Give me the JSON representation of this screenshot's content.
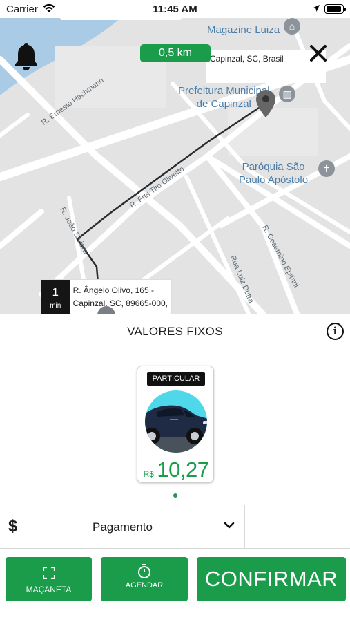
{
  "status_bar": {
    "carrier": "Carrier",
    "time": "11:45 AM"
  },
  "map": {
    "distance": "0,5 km",
    "destination": "Capinzal, SC, Brasil",
    "poi_magazine": "Magazine Luiza",
    "poi_prefeitura_line1": "Prefeitura Municipal",
    "poi_prefeitura_line2": "de Capinzal",
    "poi_paroquia_line1": "Paróquia São",
    "poi_paroquia_line2": "Paulo Apóstolo",
    "street_ernesto": "R. Ernesto Hachmann",
    "street_frei": "R. Frei Tito Olivetto",
    "street_joao": "R. João Siviero",
    "street_cosemino": "R. Cosemino Epifani",
    "street_luiz": "Rua Luiz Dutra",
    "eta_value": "1",
    "eta_unit": "min",
    "origin_line1": "R. Ângelo Olivo, 165 -",
    "origin_line2": "Capinzal, SC, 89665-000,"
  },
  "panel": {
    "section_title": "VALORES FIXOS",
    "vehicle_category": "PARTICULAR",
    "currency": "R$",
    "price": "10,27",
    "payment_label": "Pagamento",
    "handle_label": "MAÇANETA",
    "schedule_label": "AGENDAR",
    "confirm_label": "CONFIRMAR"
  },
  "colors": {
    "accent_green": "#1a9c4b",
    "map_background": "#e3e3e3",
    "water": "#aacbe6"
  }
}
